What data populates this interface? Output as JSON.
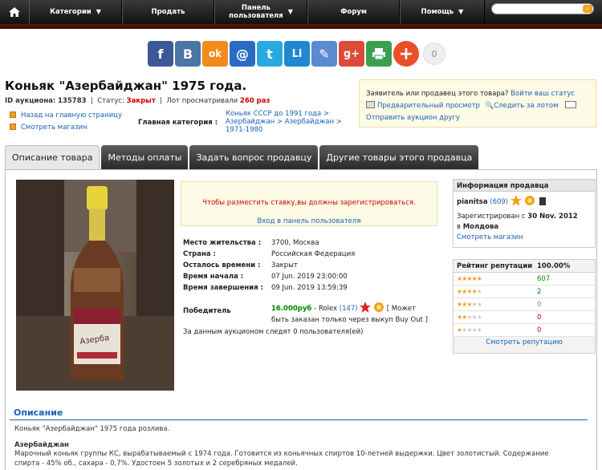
{
  "nav": {
    "items": [
      "Категории",
      "Продать",
      "Панель\nпользователя",
      "Форум",
      "Помощь"
    ]
  },
  "share": {
    "buttons": [
      "f",
      "B",
      "ok",
      "@",
      "t",
      "Li",
      "✎",
      "g+",
      "print",
      "+"
    ],
    "count": "0"
  },
  "lot": {
    "title": "Коньяк \"Азербайджан\" 1975 года.",
    "id_label": "ID аукциона:",
    "id_value": "135783",
    "status_label": "Статус:",
    "status_value": "Закрыт",
    "views_label": "Лот просматривали",
    "views_value": "260 раз",
    "back_link": "Назад на главную страницу",
    "shop_link": "Смотреть магазин",
    "category_label": "Главная категория :",
    "category_path": "Коньяк СССР до 1991 года > Азербайджан > Азербайджан > 1971-1980"
  },
  "seller_box": {
    "line1": "Заявитель или продавец этого товара?",
    "login_link": "Войти ваш статус",
    "preview": "Предварительный просмотр",
    "watch": "Следить за лотом",
    "send": "Отправить аукцион другу"
  },
  "tabs": [
    "Описание товара",
    "Методы оплаты",
    "Задать вопрос продавцу",
    "Другие товары этого продавца"
  ],
  "login_notice": {
    "error": "Чтобы разместить ставку,вы должны зарегистрироваться.",
    "link": "Вход в панель пользователя"
  },
  "details": {
    "location_label": "Место жительства :",
    "location_value": "3700, Москва",
    "country_label": "Страна :",
    "country_value": "Российская Федерация",
    "time_left_label": "Осталось времени :",
    "time_left_value": "Закрыт",
    "start_label": "Время начала :",
    "start_value": "07 Jun. 2019 23:00:00",
    "end_label": "Время завершения :",
    "end_value": "09 Jun. 2019 13:59:39",
    "winner_label": "Победитель",
    "winner_price": "16.000руб",
    "winner_sep": " - Rolex ",
    "winner_score": "(147)",
    "winner_note_1": "[ Может",
    "winner_note_2": "быть заказан только через выкуп Buy Out ]",
    "followers": "За данным аукционом следят 0 пользователя(ей)"
  },
  "seller_info": {
    "title": "Информация продавца",
    "name": "pianitsa",
    "score": "(609)",
    "registered_prefix": "Зарегистрирован с",
    "registered_date": "30 Nov. 2012",
    "location_prefix": "в",
    "location": "Молдова",
    "shop_link": "Смотреть магазин"
  },
  "reputation": {
    "title": "Рейтинг репутации",
    "percent": "100.00%",
    "rows": [
      {
        "stars": 5,
        "count": "607",
        "color": "#080"
      },
      {
        "stars": 4,
        "count": "2",
        "color": "#080"
      },
      {
        "stars": 3,
        "count": "0",
        "color": "#888"
      },
      {
        "stars": 2,
        "count": "0",
        "color": "#c00"
      },
      {
        "stars": 1,
        "count": "0",
        "color": "#c00"
      }
    ],
    "link": "Смотреть репутацию"
  },
  "description": {
    "title": "Описание",
    "line1": "Коньяк \"Азербайджан\" 1975 года розлива.",
    "heading": "Азербайджан",
    "line2": "Марочный коньяк группы КС, вырабатываемый с 1974 года. Готовится из коньячных спиртов 10-летней выдержки. Цвет золотистый. Содержание",
    "line3": "спирта - 45% об., сахара - 0,7%. Удостоен 5 золотых и 2 серебряных медалей."
  },
  "colors": {
    "nav_bg": "#1e1e1e",
    "link": "#1a5fb4",
    "status_red": "#cc0000",
    "price_green": "#008800",
    "notice_bg": "#fdfbe6"
  }
}
